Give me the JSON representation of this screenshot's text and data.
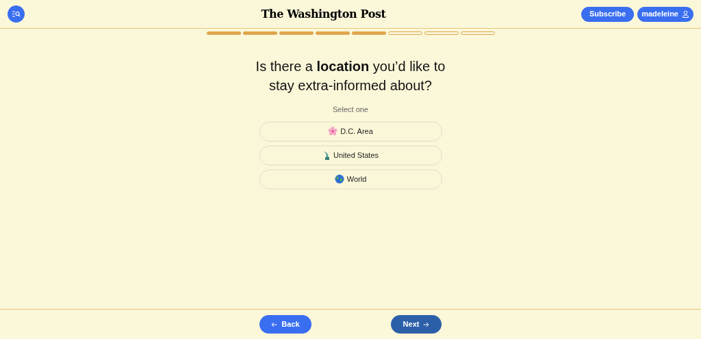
{
  "header": {
    "logo": "The Washington Post",
    "subscribe": "Subscribe",
    "account": "madeleine"
  },
  "progress": [
    {
      "done": true
    },
    {
      "done": true
    },
    {
      "done": true
    },
    {
      "done": true
    },
    {
      "done": true
    },
    {
      "done": false
    },
    {
      "done": false
    },
    {
      "done": false
    }
  ],
  "question": "Is there a **location** you’d like to stay extra-informed about?",
  "hint": "Select one",
  "options": [
    {
      "kind": "flower",
      "label": "D.C. Area",
      "selected": false
    },
    {
      "kind": "statue",
      "label": "United States",
      "selected": false
    },
    {
      "kind": "globe",
      "label": "World",
      "selected": false
    }
  ],
  "footer": {
    "back": "Back",
    "next": "Next"
  }
}
